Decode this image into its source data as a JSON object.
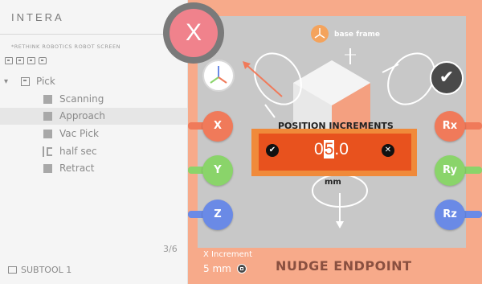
{
  "left_panel": {
    "app_title": "INTERA",
    "screen_caption": "*RETHINK ROBOTICS ROBOT SCREEN",
    "toolbar_icons": [
      "task-icon",
      "task-icon",
      "task-icon",
      "settings-icon"
    ],
    "tree": {
      "root": {
        "label": "Pick",
        "icon": "task-icon",
        "expanded": true
      },
      "children": [
        {
          "label": "Scanning",
          "icon": "square-icon",
          "selected": false
        },
        {
          "label": "Approach",
          "icon": "square-icon",
          "selected": true
        },
        {
          "label": "Vac Pick",
          "icon": "square-icon",
          "selected": false
        },
        {
          "label": "half sec",
          "icon": "wait-icon",
          "selected": false
        },
        {
          "label": "Retract",
          "icon": "square-icon",
          "selected": false
        }
      ]
    },
    "page_count": "3/6",
    "subtool_label": "SUBTOOL 1"
  },
  "nudge": {
    "close_label": "X",
    "confirm_icon": "checkmark-icon",
    "frame_label": "base frame",
    "axis_buttons": [
      {
        "label": "X",
        "color": "#f07a5a"
      },
      {
        "label": "Y",
        "color": "#8ad46a"
      },
      {
        "label": "Z",
        "color": "#6a8ae6"
      },
      {
        "label": "Rx",
        "color": "#f07a5a"
      },
      {
        "label": "Ry",
        "color": "#8ad46a"
      },
      {
        "label": "Rz",
        "color": "#6a8ae6"
      }
    ],
    "title": "POSITION INCREMENTS",
    "value_pre": "0",
    "value_cursor": "5",
    "value_post": ".0",
    "unit": "mm",
    "increment_label": "X Increment",
    "increment_value": "5 mm",
    "panel_title": "NUDGE ENDPOINT"
  },
  "colors": {
    "panel_bg": "#f7aa8a",
    "viewport_bg": "#c8c8c8",
    "value_box": "#e8521e",
    "value_frame": "#f08a3a",
    "close_button": "#f0828c"
  }
}
